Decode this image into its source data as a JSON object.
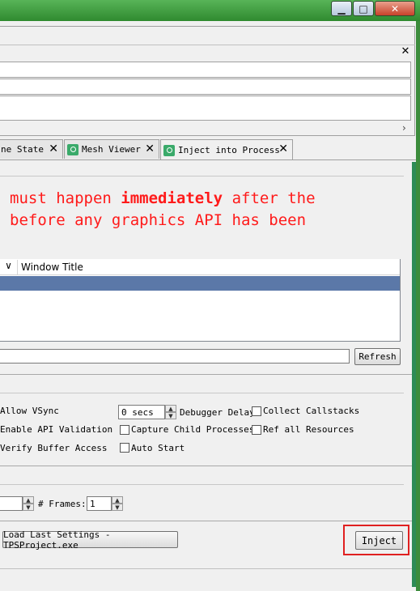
{
  "window": {
    "buttons": [
      "minimize",
      "maximize",
      "close"
    ]
  },
  "top_panel": {
    "close_glyph": "✕",
    "scroll_arrow": "›"
  },
  "tabs": [
    {
      "label": "ne State",
      "icon": "none"
    },
    {
      "label": "Mesh Viewer",
      "icon": "user-icon"
    },
    {
      "label": "Inject into Process",
      "icon": "user-icon",
      "active": true
    }
  ],
  "tab_close_glyph": "✕",
  "warning": {
    "line1_pre": "must happen ",
    "line1_bold": "immediately",
    "line1_post": " after the",
    "line2": "before any graphics API has been",
    "color": "#ff1a1a"
  },
  "process_list": {
    "sort_glyph": "∨",
    "column_title": "Window Title",
    "selected_color": "#5b78a8"
  },
  "filter": {
    "value": "",
    "refresh_label": "Refresh"
  },
  "options": {
    "allow_vsync": "Allow VSync",
    "enable_api_validation": "Enable API Validation",
    "verify_buffer_access": "Verify Buffer Access",
    "debugger_delay_value": "0 secs",
    "debugger_delay_label": "Debugger Delay",
    "capture_child_processes": "Capture Child Processes",
    "auto_start": "Auto Start",
    "collect_callstacks": "Collect Callstacks",
    "ref_all_resources": "Ref all Resources"
  },
  "capture": {
    "frame_value": "",
    "frames_label": "# Frames:",
    "frames_value": "1"
  },
  "actions": {
    "load_last_settings": "Load Last Settings - TPSProject.exe",
    "inject": "Inject"
  },
  "spin_up": "▲",
  "spin_down": "▼"
}
